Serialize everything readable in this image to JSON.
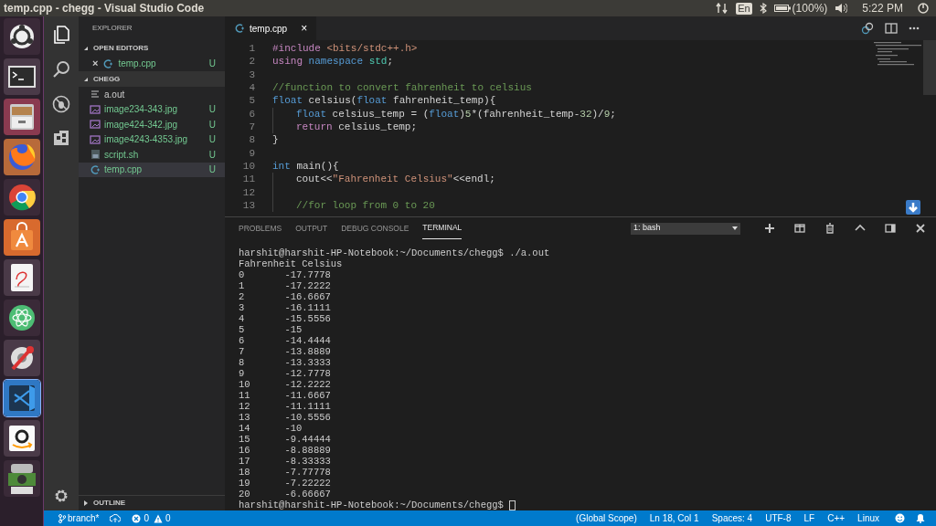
{
  "topbar": {
    "title": "temp.cpp - chegg - Visual Studio Code",
    "keyboard": "En",
    "battery": "(100%)",
    "clock": "5:22 PM"
  },
  "launcher": [
    {
      "kind": "ubuntu"
    },
    {
      "kind": "terminal"
    },
    {
      "kind": "files"
    },
    {
      "kind": "firefox"
    },
    {
      "kind": "chrome"
    },
    {
      "kind": "store"
    },
    {
      "kind": "document"
    },
    {
      "kind": "atom"
    },
    {
      "kind": "settings"
    },
    {
      "kind": "vscode",
      "selected": true
    },
    {
      "kind": "amazon"
    },
    {
      "kind": "stack"
    }
  ],
  "sidebar": {
    "title": "EXPLORER",
    "open_editors": {
      "label": "OPEN EDITORS",
      "items": [
        {
          "close": "×",
          "name": "temp.cpp",
          "status": "U",
          "kind": "cpp"
        }
      ]
    },
    "folder": {
      "label": "CHEGG",
      "items": [
        {
          "name": "a.out",
          "kind": "text",
          "selected": false
        },
        {
          "name": "image234-343.jpg",
          "kind": "image",
          "status": "U",
          "selected": false
        },
        {
          "name": "image424-342.jpg",
          "kind": "image",
          "status": "U",
          "selected": false
        },
        {
          "name": "image4243-4353.jpg",
          "kind": "image",
          "status": "U",
          "selected": false
        },
        {
          "name": "script.sh",
          "kind": "shell",
          "status": "U",
          "selected": false
        },
        {
          "name": "temp.cpp",
          "kind": "cpp",
          "status": "U",
          "selected": true
        }
      ]
    },
    "outline": "OUTLINE"
  },
  "editor": {
    "tab": {
      "label": "temp.cpp",
      "close": "×"
    },
    "lines": [
      {
        "number": "1",
        "tokens": [
          {
            "text": "#include ",
            "kind": "keyword"
          },
          {
            "text": "<bits/stdc++.h>",
            "kind": "string"
          }
        ]
      },
      {
        "number": "2",
        "tokens": [
          {
            "text": "using ",
            "kind": "keyword"
          },
          {
            "text": "namespace ",
            "kind": "type"
          },
          {
            "text": "std",
            "kind": "namespace"
          },
          {
            "text": ";",
            "kind": "plain"
          }
        ]
      },
      {
        "number": "3"
      },
      {
        "number": "4",
        "tokens": [
          {
            "text": "//function to convert fahrenheit to celsius",
            "kind": "comment"
          }
        ]
      },
      {
        "number": "5",
        "tokens": [
          {
            "text": "float ",
            "kind": "type"
          },
          {
            "text": "celsius(",
            "kind": "plain"
          },
          {
            "text": "float ",
            "kind": "type"
          },
          {
            "text": "fahrenheit_temp){",
            "kind": "plain"
          }
        ]
      },
      {
        "number": "6",
        "indented": true,
        "tokens": [
          {
            "text": "float ",
            "kind": "type"
          },
          {
            "text": "celsius_temp = (",
            "kind": "plain"
          },
          {
            "text": "float",
            "kind": "type"
          },
          {
            "text": ")",
            "kind": "plain"
          },
          {
            "text": "5",
            "kind": "number"
          },
          {
            "text": "*(fahrenheit_temp-",
            "kind": "plain"
          },
          {
            "text": "32",
            "kind": "number"
          },
          {
            "text": ")/",
            "kind": "plain"
          },
          {
            "text": "9",
            "kind": "number"
          },
          {
            "text": ";",
            "kind": "plain"
          }
        ]
      },
      {
        "number": "7",
        "indented": true,
        "tokens": [
          {
            "text": "return ",
            "kind": "keyword"
          },
          {
            "text": "celsius_temp;",
            "kind": "plain"
          }
        ]
      },
      {
        "number": "8",
        "tokens": [
          {
            "text": "}",
            "kind": "plain"
          }
        ]
      },
      {
        "number": "9"
      },
      {
        "number": "10",
        "tokens": [
          {
            "text": "int ",
            "kind": "type"
          },
          {
            "text": "main(){",
            "kind": "plain"
          }
        ]
      },
      {
        "number": "11",
        "indented": true,
        "tokens": [
          {
            "text": "cout<<",
            "kind": "plain"
          },
          {
            "text": "\"Fahrenheit Celsius\"",
            "kind": "string"
          },
          {
            "text": "<<endl;",
            "kind": "plain"
          }
        ]
      },
      {
        "number": "12",
        "indented": true
      },
      {
        "number": "13",
        "indented": true,
        "tokens": [
          {
            "text": "//for loop from 0 to 20",
            "kind": "comment"
          }
        ]
      }
    ]
  },
  "panel": {
    "tabs": [
      {
        "label": "PROBLEMS",
        "selected": false
      },
      {
        "label": "OUTPUT",
        "selected": false
      },
      {
        "label": "DEBUG CONSOLE",
        "selected": false
      },
      {
        "label": "TERMINAL",
        "selected": true
      }
    ],
    "terminal_select": "1: bash",
    "terminal": [
      "harshit@harshit-HP-Notebook:~/Documents/chegg$ ./a.out",
      "Fahrenheit Celsius",
      "0       -17.7778",
      "1       -17.2222",
      "2       -16.6667",
      "3       -16.1111",
      "4       -15.5556",
      "5       -15",
      "6       -14.4444",
      "7       -13.8889",
      "8       -13.3333",
      "9       -12.7778",
      "10      -12.2222",
      "11      -11.6667",
      "12      -11.1111",
      "13      -10.5556",
      "14      -10",
      "15      -9.44444",
      "16      -8.88889",
      "17      -8.33333",
      "18      -7.77778",
      "19      -7.22222",
      "20      -6.66667"
    ],
    "prompt": "harshit@harshit-HP-Notebook:~/Documents/chegg$ "
  },
  "status_bar": {
    "branch": "branch*",
    "errors": "0",
    "warnings": "0",
    "right": [
      "(Global Scope)",
      "Ln 18, Col 1",
      "Spaces: 4",
      "UTF-8",
      "LF",
      "C++",
      "Linux"
    ]
  }
}
